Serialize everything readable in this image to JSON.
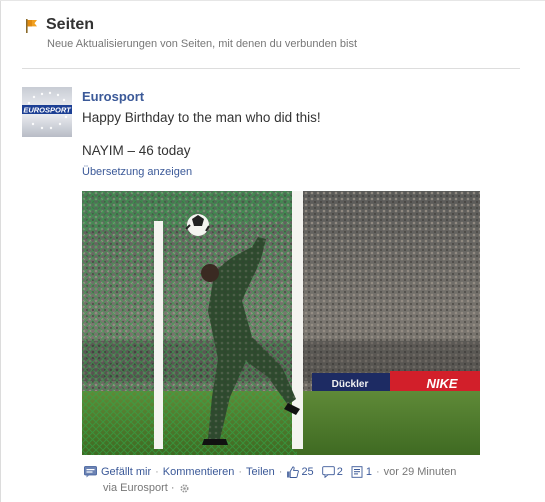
{
  "header": {
    "title": "Seiten",
    "subtitle": "Neue Aktualisierungen von Seiten, mit denen du verbunden bist"
  },
  "post": {
    "author": "Eurosport",
    "avatar_text": "EUROSPORT",
    "message_line1": "Happy Birthday to the man who did this!",
    "message_line2": "NAYIM – 46 today",
    "translate_link": "Übersetzung anzeigen",
    "photo_ad_text": "NIKE"
  },
  "actions": {
    "like": "Gefällt mir",
    "comment": "Kommentieren",
    "share": "Teilen",
    "likes_count": "25",
    "comments_count": "2",
    "shares_count": "1",
    "time": "vor 29 Minuten",
    "separator": "·",
    "via": "via Eurosport ·"
  },
  "colors": {
    "link": "#3b5998",
    "muted": "#777777",
    "divider": "#dddddd",
    "flag": "#f0a020"
  },
  "icons": [
    "flag-icon",
    "comment-bubble-icon",
    "thumbs-up-icon",
    "share-icon",
    "gear-icon"
  ]
}
